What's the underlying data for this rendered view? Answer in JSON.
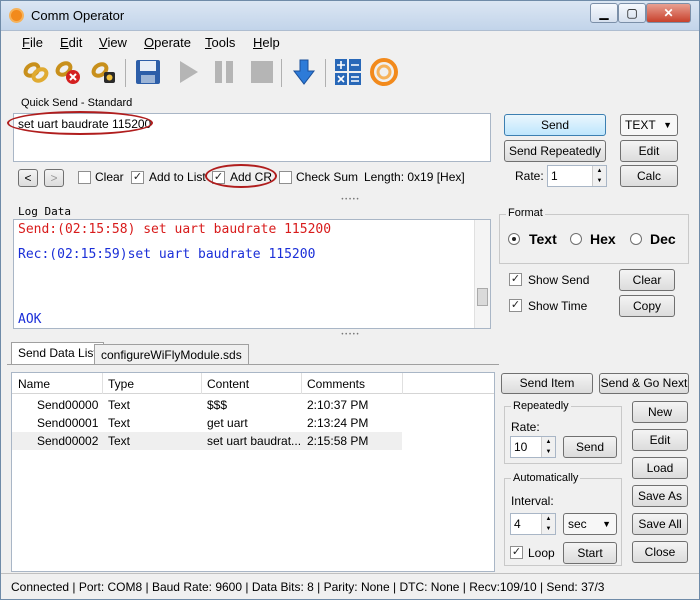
{
  "window": {
    "title": "Comm Operator",
    "min": "▁",
    "max": "▢",
    "close": "✕"
  },
  "menu": [
    {
      "pre": "",
      "u": "F",
      "post": "ile"
    },
    {
      "pre": "",
      "u": "E",
      "post": "dit"
    },
    {
      "pre": "",
      "u": "V",
      "post": "iew"
    },
    {
      "pre": "",
      "u": "O",
      "post": "perate"
    },
    {
      "pre": "",
      "u": "T",
      "post": "ools"
    },
    {
      "pre": "",
      "u": "H",
      "post": "elp"
    }
  ],
  "quick_send": {
    "group_title": "Quick Send - Standard",
    "text": "set uart baudrate 115200",
    "send_label": "Send",
    "send_repeatedly_label": "Send Repeatedly",
    "mode_value": "TEXT",
    "edit_label": "Edit",
    "rate_label": "Rate:",
    "rate_value": "1",
    "calc_label": "Calc",
    "prev": "<",
    "next": ">",
    "clear_label": "Clear",
    "add_to_list_label": "Add to List",
    "add_cr_label": "Add CR",
    "check_sum_label": "Check Sum",
    "length_text": "Length: 0x19 [Hex]",
    "clear_checked": false,
    "add_to_list_checked": true,
    "add_cr_checked": true,
    "check_sum_checked": false
  },
  "log": {
    "title": "Log Data",
    "lines": [
      {
        "text": "Send:(02:15:58) set uart baudrate 115200",
        "color": "#d81b1b"
      },
      {
        "text": "Rec:(02:15:59)set uart baudrate 115200",
        "color": "#1b2fd8"
      },
      {
        "text": "AOK",
        "color": "#1b2fd8"
      }
    ]
  },
  "format": {
    "title": "Format",
    "options": [
      "Text",
      "Hex",
      "Dec"
    ],
    "selected": "Text",
    "show_send_label": "Show Send",
    "show_time_label": "Show Time",
    "clear_label": "Clear",
    "copy_label": "Copy"
  },
  "tabs": [
    "Send Data List",
    "configureWiFlyModule.sds"
  ],
  "table": {
    "columns": [
      "Name",
      "Type",
      "Content",
      "Comments"
    ],
    "rows": [
      {
        "name": "Send00000",
        "type": "Text",
        "content": "$$$",
        "comments": "2:10:37 PM"
      },
      {
        "name": "Send00001",
        "type": "Text",
        "content": "get uart",
        "comments": "2:13:24 PM"
      },
      {
        "name": "Send00002",
        "type": "Text",
        "content": "set uart baudrat...",
        "comments": "2:15:58 PM"
      }
    ]
  },
  "list_panel": {
    "send_item_label": "Send Item",
    "send_go_next_label": "Send & Go Next",
    "repeatedly_title": "Repeatedly",
    "rate_label": "Rate:",
    "rate_value": "10",
    "send_label": "Send",
    "automatically_title": "Automatically",
    "interval_label": "Interval:",
    "interval_value": "4",
    "interval_unit": "sec",
    "loop_label": "Loop",
    "start_label": "Start",
    "new_label": "New",
    "edit_label": "Edit",
    "load_label": "Load",
    "save_as_label": "Save As",
    "save_all_label": "Save All",
    "close_label": "Close"
  },
  "status": "Connected | Port: COM8 | Baud Rate: 9600 | Data Bits: 8 | Parity: None | DTC: None | Recv:109/10 | Send: 37/3",
  "toolbar_icons": [
    "connect-icon",
    "disconnect-icon",
    "port-settings-icon",
    "save-icon",
    "play-icon",
    "pause-icon",
    "stop-icon",
    "download-icon",
    "calculator-icon",
    "comm-operator-logo-icon"
  ]
}
